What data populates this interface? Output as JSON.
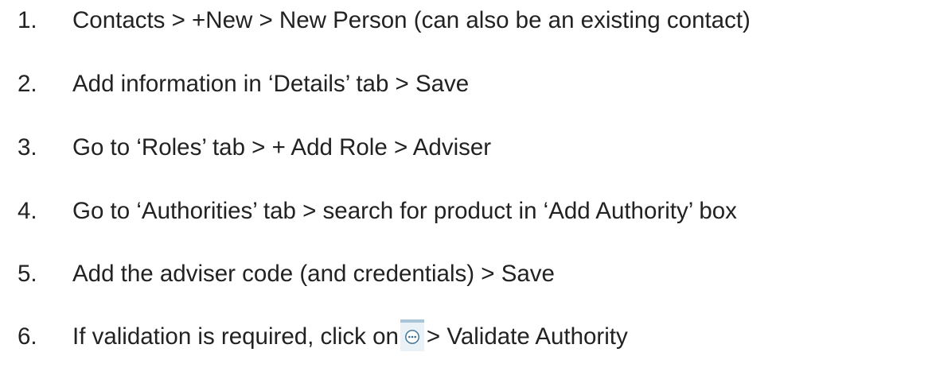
{
  "steps": [
    {
      "number": "1.",
      "text": "Contacts > +New > New Person (can also be an existing contact)"
    },
    {
      "number": "2.",
      "text": "Add information in ‘Details’ tab > Save"
    },
    {
      "number": "3.",
      "text": "Go to ‘Roles’ tab > + Add Role > Adviser"
    },
    {
      "number": "4.",
      "text": "Go to ‘Authorities’ tab > search for product in ‘Add Authority’ box"
    },
    {
      "number": "5.",
      "text": "Add the adviser code (and credentials) > Save"
    },
    {
      "number": "6.",
      "text_before_icon": "If validation is required, click on",
      "icon": "more-options-icon",
      "text_after_icon": "> Validate Authority"
    }
  ],
  "colors": {
    "text": "#222222",
    "icon_bg": "#eaf2f8",
    "icon_border": "#a9c4d6",
    "icon_stroke": "#3a6e8f"
  }
}
